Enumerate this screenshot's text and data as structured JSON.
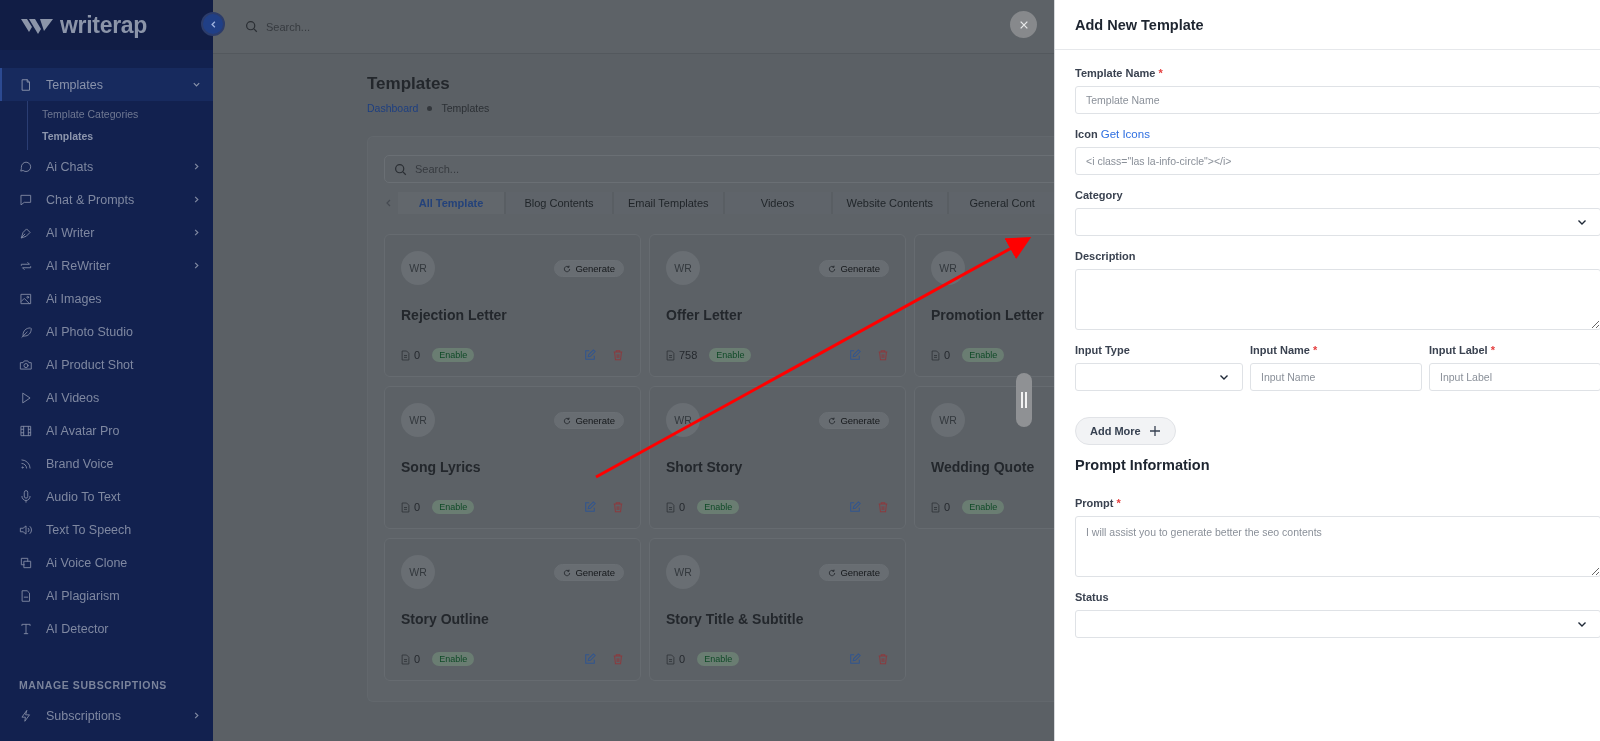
{
  "sidebar": {
    "logo": "writerap",
    "items": [
      {
        "label": "Templates",
        "expandable": true,
        "expanded": true,
        "selected": true,
        "children": [
          {
            "label": "Template Categories",
            "selected": false
          },
          {
            "label": "Templates",
            "selected": true
          }
        ]
      },
      {
        "label": "Ai Chats",
        "expandable": true,
        "expanded": false,
        "selected": false
      },
      {
        "label": "Chat & Prompts",
        "expandable": true,
        "expanded": false,
        "selected": false
      },
      {
        "label": "AI Writer",
        "expandable": true,
        "expanded": false,
        "selected": false
      },
      {
        "label": "AI ReWriter",
        "expandable": true,
        "expanded": false,
        "selected": false
      },
      {
        "label": "Ai Images",
        "expandable": false,
        "selected": false
      },
      {
        "label": "AI Photo Studio",
        "expandable": false,
        "selected": false
      },
      {
        "label": "AI Product Shot",
        "expandable": false,
        "selected": false
      },
      {
        "label": "AI Videos",
        "expandable": false,
        "selected": false
      },
      {
        "label": "AI Avatar Pro",
        "expandable": false,
        "selected": false
      },
      {
        "label": "Brand Voice",
        "expandable": false,
        "selected": false
      },
      {
        "label": "Audio To Text",
        "expandable": false,
        "selected": false
      },
      {
        "label": "Text To Speech",
        "expandable": false,
        "selected": false
      },
      {
        "label": "Ai Voice Clone",
        "expandable": false,
        "selected": false
      },
      {
        "label": "AI Plagiarism",
        "expandable": false,
        "selected": false
      },
      {
        "label": "AI Detector",
        "expandable": false,
        "selected": false
      }
    ],
    "section_label": "MANAGE SUBSCRIPTIONS",
    "section_items": [
      {
        "label": "Subscriptions",
        "expandable": true,
        "expanded": false,
        "selected": false
      }
    ]
  },
  "topbar": {
    "search": {
      "placeholder": "Search..."
    }
  },
  "page": {
    "title": "Templates",
    "breadcrumb": [
      {
        "label": "Dashboard",
        "link": true
      },
      {
        "label": "Templates",
        "link": false
      }
    ]
  },
  "templates": {
    "search": {
      "placeholder": "Search..."
    },
    "tabs": [
      {
        "label": "All Template",
        "selected": true
      },
      {
        "label": "Blog Contents",
        "selected": false
      },
      {
        "label": "Email Templates",
        "selected": false
      },
      {
        "label": "Videos",
        "selected": false
      },
      {
        "label": "Website Contents",
        "selected": false
      },
      {
        "label": "General Cont",
        "selected": false
      }
    ],
    "cards": [
      {
        "initials": "WR",
        "generate": "Generate",
        "title": "Rejection Letter",
        "count": "0",
        "status": "Enable"
      },
      {
        "initials": "WR",
        "generate": "Generate",
        "title": "Offer Letter",
        "count": "758",
        "status": "Enable"
      },
      {
        "initials": "WR",
        "title": "Promotion Letter",
        "count": "0",
        "status": "Enable"
      },
      {
        "initials": "WR",
        "generate": "Generate",
        "title": "Song Lyrics",
        "count": "0",
        "status": "Enable"
      },
      {
        "initials": "WR",
        "generate": "Generate",
        "title": "Short Story",
        "count": "0",
        "status": "Enable"
      },
      {
        "initials": "WR",
        "title": "Wedding Quote",
        "count": "0",
        "status": "Enable"
      },
      {
        "initials": "WR",
        "generate": "Generate",
        "title": "Story Outline",
        "count": "0",
        "status": "Enable"
      },
      {
        "initials": "WR",
        "generate": "Generate",
        "title": "Story Title & Subtitle",
        "count": "0",
        "status": "Enable"
      }
    ]
  },
  "drawer": {
    "title": "Add New Template",
    "fields": [
      {
        "kind": "input",
        "label": "Template Name",
        "required_mark": "*",
        "placeholder": "Template Name"
      },
      {
        "kind": "input",
        "label": "Icon",
        "link": "Get Icons",
        "placeholder": "<i class=\"las la-info-circle\"></i>"
      },
      {
        "kind": "select",
        "label": "Category"
      },
      {
        "kind": "textarea",
        "label": "Description"
      },
      {
        "kind": "row",
        "fields": [
          {
            "kind": "select",
            "label": "Input Type"
          },
          {
            "kind": "input",
            "label": "Input Name",
            "required_mark": "*",
            "placeholder": "Input Name"
          },
          {
            "kind": "input",
            "label": "Input Label",
            "required_mark": "*",
            "placeholder": "Input Label"
          }
        ]
      },
      {
        "kind": "button",
        "label": "Add More"
      },
      {
        "kind": "heading",
        "label": "Prompt Information"
      },
      {
        "kind": "textarea",
        "label": "Prompt",
        "required_mark": "*",
        "placeholder": "I will assist you to generate better the seo contents"
      },
      {
        "kind": "select",
        "label": "Status"
      }
    ]
  }
}
